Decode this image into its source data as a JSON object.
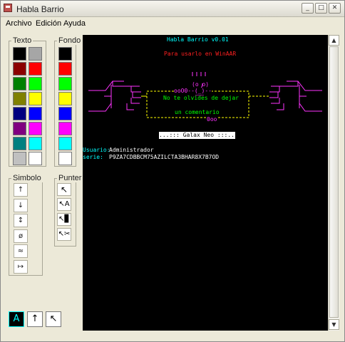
{
  "window": {
    "title": "Habla Barrio",
    "minimize": "_",
    "maximize": "□",
    "close": "✕"
  },
  "menu": {
    "archivo": "Archivo",
    "edicion": "Edición",
    "ayuda": "Ayuda"
  },
  "groups": {
    "texto": "Texto",
    "fondo": "Fondo",
    "simbolo": "Simbolo",
    "puntero": "Punter"
  },
  "colors": {
    "texto": [
      "#000000",
      "#a6a6a6",
      "#8b0000",
      "#ff0000",
      "#008000",
      "#00ff00",
      "#808000",
      "#ffff00",
      "#000080",
      "#0000ff",
      "#800080",
      "#ff00ff",
      "#008080",
      "#00ffff",
      "#c0c0c0",
      "#ffffff"
    ],
    "fondo": [
      "#000000",
      "#ff0000",
      "#00ff00",
      "#ffff00",
      "#0000ff",
      "#ff00ff",
      "#00ffff",
      "#ffffff"
    ]
  },
  "symbols": [
    "↑",
    "↓",
    "↕",
    "ø",
    "≈",
    "↦"
  ],
  "pointers": [
    "↖",
    "↖A",
    "↖▊",
    "↖✂"
  ],
  "bottom_buttons": [
    "A",
    "↑",
    "↖"
  ],
  "terminal": {
    "title": "Habla Barrio v0.01",
    "subtitle": "Para usarlo en WinAAR",
    "art_face": "\\|||/\n(o o)",
    "art_top": "ooO0--(_)--",
    "msg1": "No te olvides de dejar",
    "msg2": "un comentario",
    "art_bottom": "0oo",
    "badge": "...::: Galax Neo :::...",
    "user_label": "Usuario:",
    "user_value": "Administrador",
    "serie_label": "serie:",
    "serie_value": "P9ZA7CDBBCM75AZILCTA3BHAR8X7B7OD"
  },
  "accent": {
    "cyan": "#00ffff",
    "red": "#ff2020",
    "magenta": "#ff00ff",
    "yellow": "#ffff00",
    "green": "#00ff00",
    "white": "#ffffff"
  }
}
